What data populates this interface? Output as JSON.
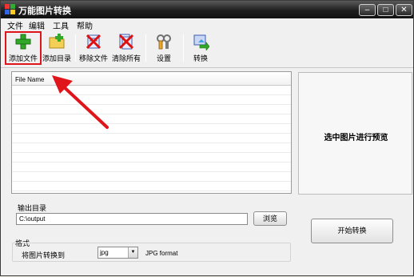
{
  "window": {
    "title": "万能图片转换"
  },
  "menu": [
    "文件",
    "编辑",
    "工具",
    "帮助"
  ],
  "toolbar": {
    "add_file": "添加文件",
    "add_folder": "添加目录",
    "remove_file": "移除文件",
    "clear_all": "清除所有",
    "settings": "设置",
    "convert": "转换"
  },
  "filelist": {
    "column_header": "File Name"
  },
  "preview": {
    "text": "选中图片进行预览"
  },
  "output": {
    "label": "输出目录",
    "path": "C:\\output",
    "browse": "浏览"
  },
  "format": {
    "group_label": "格式",
    "convert_to_label": "将图片转换到",
    "selected": "jpg",
    "description": "JPG format"
  },
  "start_button": "开始转换",
  "colors": {
    "highlight": "#e0141b",
    "titlebar": "#1f1f1f"
  }
}
